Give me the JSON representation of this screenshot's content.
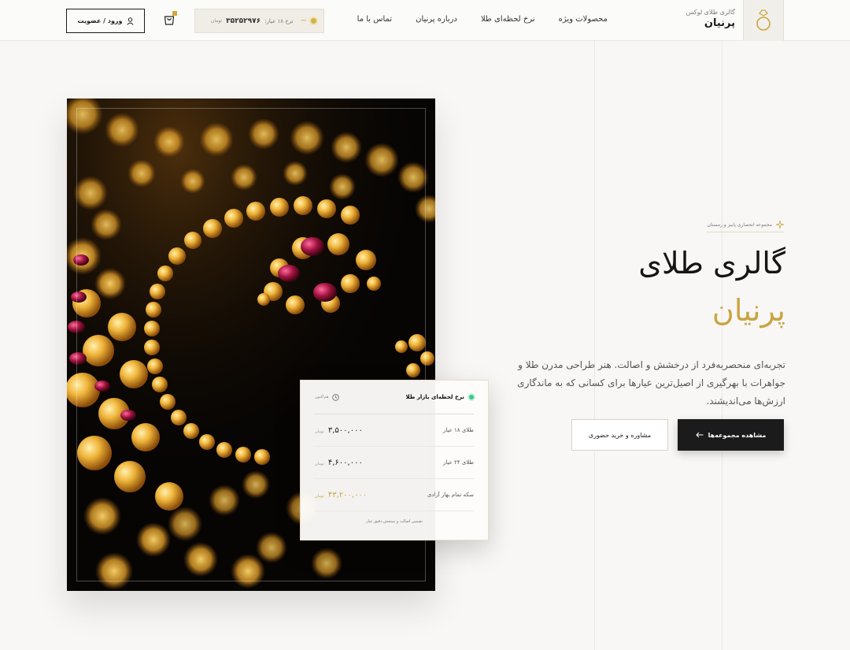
{
  "header": {
    "brand_sub": "گالری طلای لوکس",
    "brand_name": "پرنیان",
    "nav": [
      "محصولات ویژه",
      "نرخ لحظه‌ای طلا",
      "درباره پرنیان",
      "تماس با ما"
    ],
    "ticker": {
      "label": "نرخ ۱۸ عیار:",
      "price": "۳۵۲۵۲۹۷۶",
      "unit": "تومان",
      "trend": "~"
    },
    "login_label": "ورود / عضویت"
  },
  "hero": {
    "tagline": "مجموعه انحصاری پاییز و زمستان",
    "title": "گالری طلای",
    "accent": "پرنیان",
    "description": "تجربه‌ای منحصربه‌فرد از درخشش و اصالت. هنر طراحی مدرن طلا و جواهرات با بهرگیری از اصیل‌ترین عیارها برای کسانی که به ماندگاری ارزش‌ها می‌اندیشند.",
    "primary_button": "مشاهده مجموعه‌ها",
    "secondary_button": "مشاوره و خرید حضوری"
  },
  "price_card": {
    "title": "نرخ لحظه‌ای بازار طلا",
    "update_label": "هم‌اکنون",
    "rows": [
      {
        "name": "طلای ۱۸ عیار",
        "value": "۳,۵۰۰,۰۰۰",
        "unit": "تومان"
      },
      {
        "name": "طلای ۲۴ عیار",
        "value": "۴,۶۰۰,۰۰۰",
        "unit": "تومان"
      },
      {
        "name": "سکه تمام بهار آزادی",
        "value": "۴۳,۲۰۰,۰۰۰",
        "unit": "تومان"
      }
    ],
    "note": "تضمین اصالت و سنجش دقیق عیار"
  },
  "colors": {
    "accent_gold": "#c9a542",
    "dark": "#1b1b1b",
    "background": "#f8f7f5",
    "live_green": "#3ec98a"
  }
}
